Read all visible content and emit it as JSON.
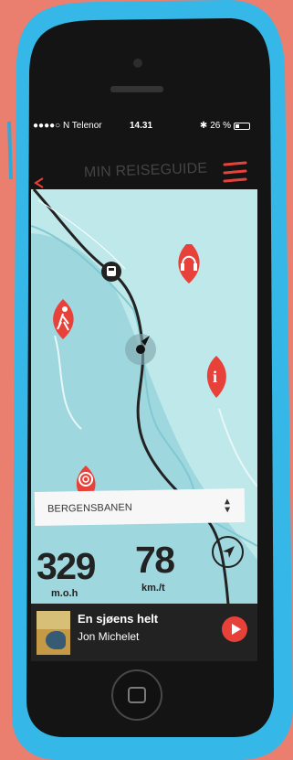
{
  "status_bar": {
    "carrier": "●●●●○ N Telenor",
    "time": "14.31",
    "battery": "26 %"
  },
  "header": {
    "title": "MIN REISEGUIDE"
  },
  "icons": {
    "back": "back-icon",
    "menu": "menu-icon",
    "headphones": "headphones-icon",
    "hiking": "hiking-icon",
    "info": "info-icon",
    "train": "train-icon",
    "navigation": "navigation-arrow-icon",
    "audio": "audio-icon",
    "play": "play-icon"
  },
  "route_selector": {
    "label": "BERGENSBANEN"
  },
  "stats": {
    "altitude_value": "329",
    "altitude_unit": "m.o.h",
    "speed_value": "78",
    "speed_unit": "km./t"
  },
  "player": {
    "title": "En sjøens helt",
    "artist": "Jon Michelet"
  },
  "colors": {
    "background": "#ea7f70",
    "phone": "#35b7e8",
    "map": "#bfe8ea",
    "water": "#9fd7df",
    "marker": "#e8413a",
    "player": "#222222"
  }
}
